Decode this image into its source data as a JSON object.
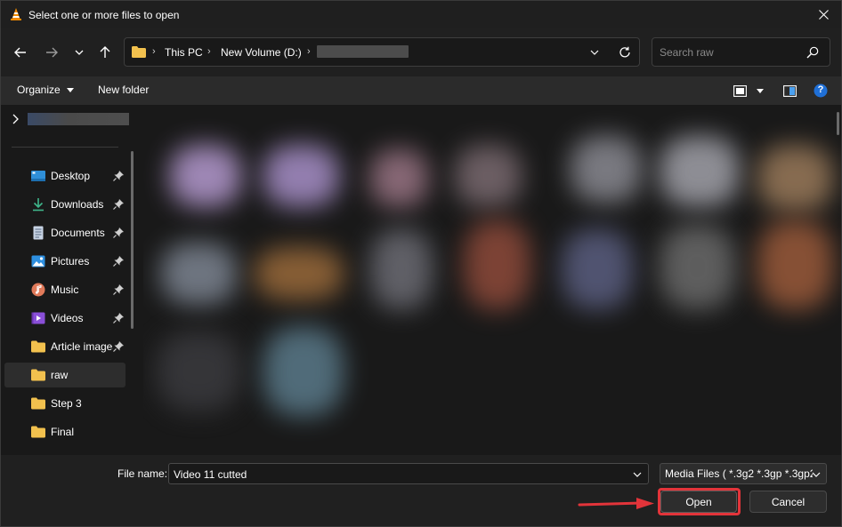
{
  "window": {
    "title": "Select one or more files to open"
  },
  "nav": {
    "breadcrumbs": [
      "This PC",
      "New Volume (D:)"
    ]
  },
  "search": {
    "placeholder": "Search raw"
  },
  "toolbar": {
    "organize_label": "Organize",
    "new_folder_label": "New folder",
    "help_label": "?"
  },
  "sidebar": {
    "items": [
      {
        "label": "Desktop",
        "icon": "desktop-icon",
        "pinned": true
      },
      {
        "label": "Downloads",
        "icon": "download-icon",
        "pinned": true
      },
      {
        "label": "Documents",
        "icon": "document-icon",
        "pinned": true
      },
      {
        "label": "Pictures",
        "icon": "pictures-icon",
        "pinned": true
      },
      {
        "label": "Music",
        "icon": "music-icon",
        "pinned": true
      },
      {
        "label": "Videos",
        "icon": "videos-icon",
        "pinned": true
      },
      {
        "label": "Article images",
        "icon": "folder-icon",
        "pinned": true
      },
      {
        "label": "raw",
        "icon": "folder-icon",
        "pinned": false,
        "selected": true
      },
      {
        "label": "Step 3",
        "icon": "folder-icon",
        "pinned": false
      },
      {
        "label": "Final",
        "icon": "folder-icon",
        "pinned": false
      }
    ]
  },
  "bottom": {
    "file_name_label": "File name:",
    "file_name_value": "Video 11 cutted",
    "filter_value": "Media Files ( *.3g2 *.3gp *.3gp2",
    "open_label": "Open",
    "cancel_label": "Cancel"
  },
  "colors": {
    "highlight": "#e2343a",
    "accent_help": "#1f6fd6",
    "folder": "#f2c14e"
  }
}
